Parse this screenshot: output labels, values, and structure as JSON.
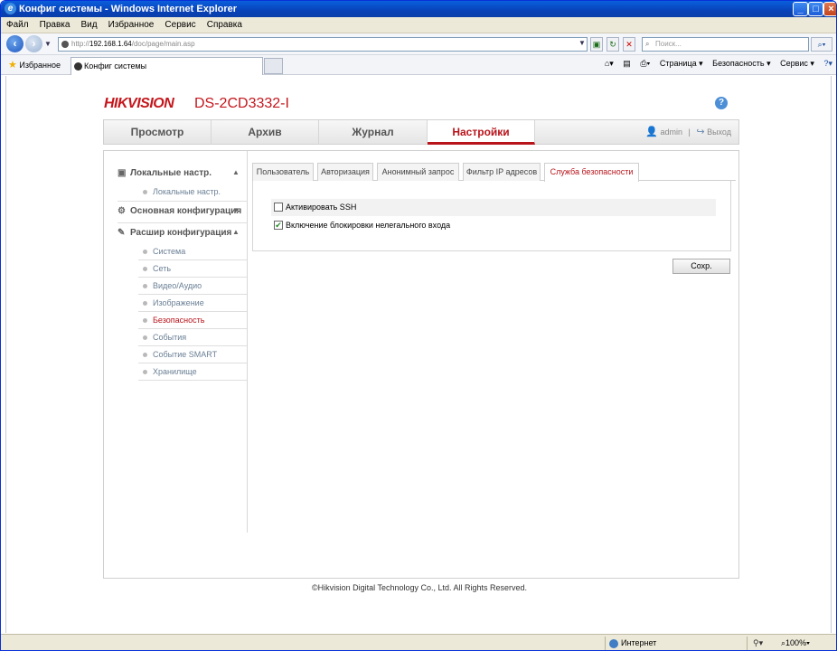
{
  "window": {
    "title": "Конфиг системы - Windows Internet Explorer",
    "buttons": [
      "_",
      "□",
      "×"
    ]
  },
  "menu": [
    "Файл",
    "Правка",
    "Вид",
    "Избранное",
    "Сервис",
    "Справка"
  ],
  "address": {
    "prefix": "http://",
    "host": "192.168.1.64",
    "path": "/doc/page/main.asp"
  },
  "search": {
    "placeholder": "Поиск..."
  },
  "favorites": {
    "label": "Избранное"
  },
  "tab": {
    "title": "Конфиг системы"
  },
  "command_bar": [
    "Страница ▾",
    "Безопасность ▾",
    "Сервис ▾"
  ],
  "app": {
    "brand": "HIKVISION",
    "model": "DS-2CD3332-I",
    "help": "?",
    "nav": [
      "Просмотр",
      "Архив",
      "Журнал",
      "Настройки"
    ],
    "active_nav": "Настройки",
    "user": "admin",
    "separator": "|",
    "logout": "Выход"
  },
  "sidebar": {
    "groups": [
      {
        "label": "Локальные настр.",
        "icon": "monitor-icon",
        "expanded": true,
        "items": [
          "Локальные настр."
        ]
      },
      {
        "label": "Основная конфигурация",
        "icon": "gear-icon",
        "expanded": false,
        "items": []
      },
      {
        "label": "Расшир конфигурация",
        "icon": "wrench-icon",
        "expanded": true,
        "items": [
          "Система",
          "Сеть",
          "Видео/Аудио",
          "Изображение",
          "Безопасность",
          "События",
          "Событие SMART",
          "Хранилище"
        ]
      }
    ],
    "active_item": "Безопасность"
  },
  "subtabs": [
    "Пользователь",
    "Авторизация",
    "Анонимный запрос",
    "Фильтр IP адресов",
    "Служба безопасности"
  ],
  "active_subtab": "Служба безопасности",
  "options": [
    {
      "label": "Активировать SSH",
      "checked": false
    },
    {
      "label": "Включение блокировки нелегального входа",
      "checked": true
    }
  ],
  "save_label": "Сохр.",
  "footer": "©Hikvision Digital Technology Co., Ltd. All Rights Reserved.",
  "status": {
    "zone": "Интернет",
    "zoom": "100%"
  },
  "colors": {
    "accent": "#b8141b",
    "brand": "#c4161c"
  }
}
